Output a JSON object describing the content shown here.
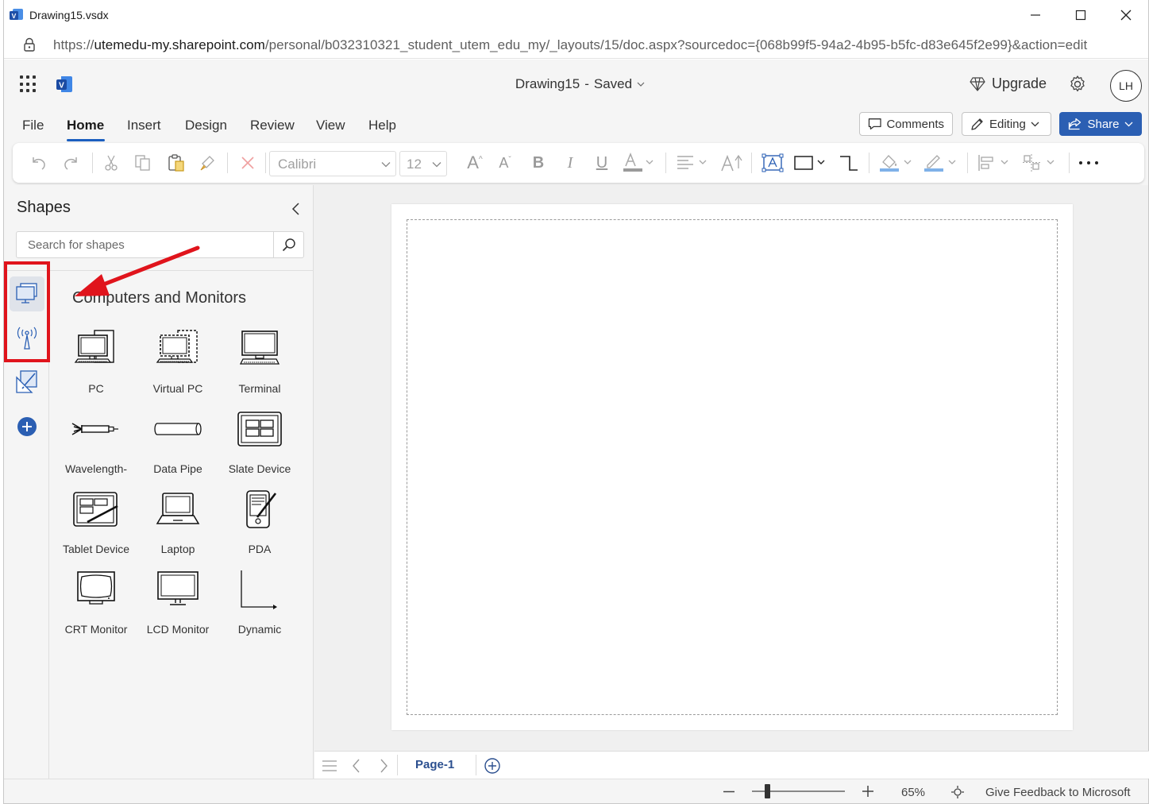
{
  "window": {
    "title": "Drawing15.vsdx"
  },
  "browser": {
    "url_prefix": "https://",
    "url_host": "utemedu-my.sharepoint.com",
    "url_path": "/personal/b032310321_student_utem_edu_my/_layouts/15/doc.aspx?sourcedoc={068b99f5-94a2-4b95-b5fc-d83e645f2e99}&action=edit"
  },
  "header": {
    "doc_name": "Drawing15",
    "separator": "-",
    "status": "Saved",
    "upgrade_label": "Upgrade",
    "avatar_initials": "LH"
  },
  "menu": {
    "items": [
      "File",
      "Home",
      "Insert",
      "Design",
      "Review",
      "View",
      "Help"
    ],
    "active": "Home",
    "comments_label": "Comments",
    "editing_label": "Editing",
    "share_label": "Share"
  },
  "ribbon": {
    "font_name": "Calibri",
    "font_size": "12"
  },
  "shapes_pane": {
    "title": "Shapes",
    "search_placeholder": "Search for shapes",
    "category_title": "Computers and Monitors",
    "stencils": [
      "computer-monitor-stencil",
      "wireless-tower-stencil",
      "drawing-tools-stencil",
      "add-stencil"
    ],
    "items": [
      {
        "label": "PC",
        "icon": "pc-icon"
      },
      {
        "label": "Virtual PC",
        "icon": "virtual-pc-icon"
      },
      {
        "label": "Terminal",
        "icon": "terminal-icon"
      },
      {
        "label": "Wavelength-",
        "icon": "wavelength-icon"
      },
      {
        "label": "Data Pipe",
        "icon": "data-pipe-icon"
      },
      {
        "label": "Slate Device",
        "icon": "slate-device-icon"
      },
      {
        "label": "Tablet Device",
        "icon": "tablet-device-icon"
      },
      {
        "label": "Laptop",
        "icon": "laptop-icon"
      },
      {
        "label": "PDA",
        "icon": "pda-icon"
      },
      {
        "label": "CRT Monitor",
        "icon": "crt-monitor-icon"
      },
      {
        "label": "LCD Monitor",
        "icon": "lcd-monitor-icon"
      },
      {
        "label": "Dynamic",
        "icon": "dynamic-connector-icon"
      }
    ]
  },
  "pages": {
    "tabs": [
      "Page-1"
    ],
    "active": "Page-1"
  },
  "status": {
    "zoom_percent": "65%",
    "zoom_fraction": 0.17,
    "feedback_label": "Give Feedback to Microsoft"
  },
  "colors": {
    "accent": "#2b5fb3",
    "highlight": "#e0141c"
  }
}
